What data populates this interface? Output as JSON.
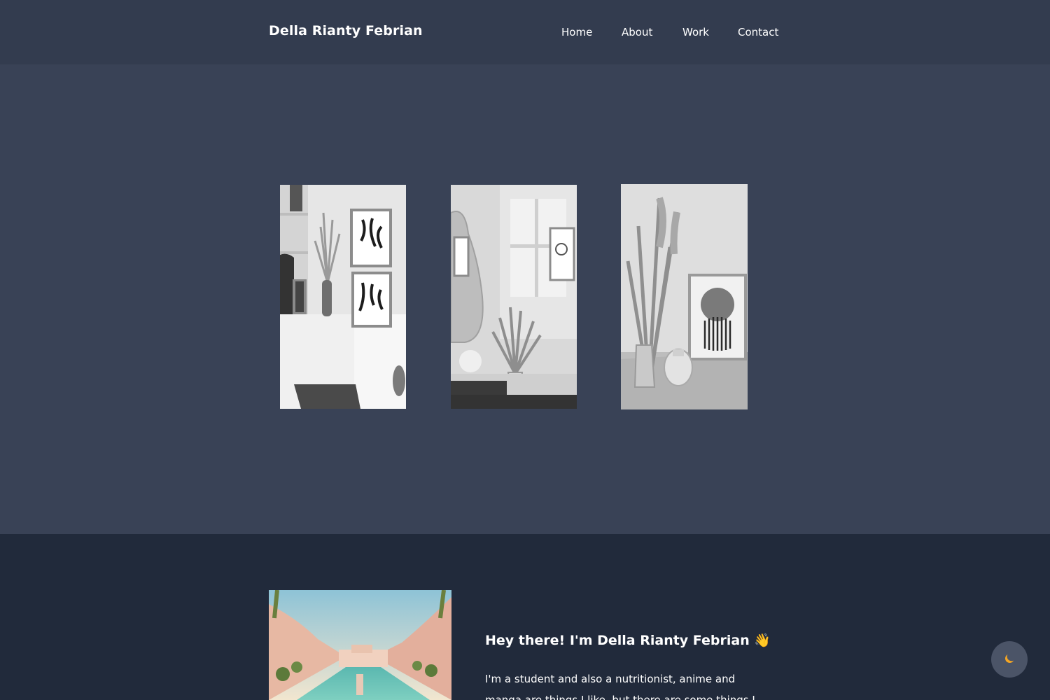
{
  "header": {
    "brand": "Della Rianty Febrian",
    "nav": [
      {
        "label": "Home"
      },
      {
        "label": "About"
      },
      {
        "label": "Work"
      },
      {
        "label": "Contact"
      }
    ]
  },
  "hero": {
    "photos": [
      {
        "icon": "interior-shelf-photo"
      },
      {
        "icon": "mirror-pampas-photo"
      },
      {
        "icon": "pampas-vase-photo"
      }
    ]
  },
  "about": {
    "image_icon": "water-castle-pool-photo",
    "title": "Hey there! I'm Della Rianty Febrian 👋",
    "text": "I'm a student and also a nutritionist, anime and manga are things I like, but there are some things I"
  },
  "theme_toggle": {
    "icon": "moon-icon",
    "accent": "#f5a623"
  },
  "colors": {
    "header_bg": "#333c4f",
    "hero_bg": "#394256",
    "about_bg": "#212a3b"
  }
}
